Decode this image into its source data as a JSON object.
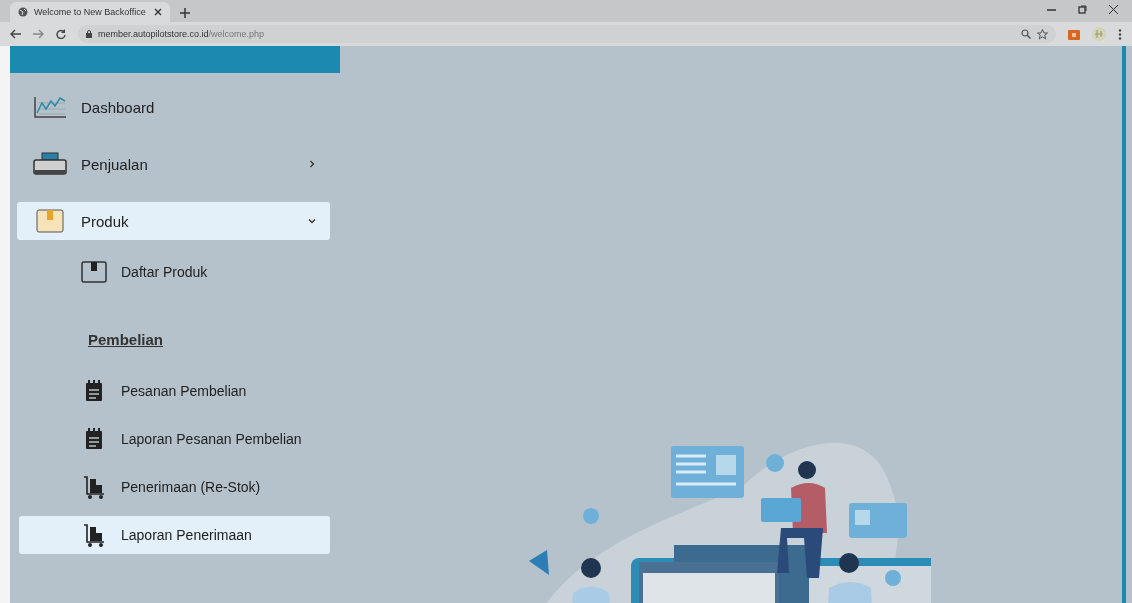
{
  "browser": {
    "tab_title": "Welcome to New Backoffice",
    "url_host": "member.autopilotstore.co.id",
    "url_path": "/welcome.php"
  },
  "sidebar": {
    "menu": [
      {
        "label": "Dashboard",
        "kind": "chart",
        "selected": false
      },
      {
        "label": "Penjualan",
        "kind": "register",
        "selected": false,
        "expanded": false
      },
      {
        "label": "Produk",
        "kind": "box",
        "selected": true,
        "expanded": true,
        "children": [
          {
            "label": "Daftar Produk",
            "kind": "box-outline",
            "selected": false
          }
        ]
      }
    ],
    "section": {
      "title": "Pembelian",
      "items": [
        {
          "label": "Pesanan Pembelian",
          "kind": "notepad",
          "selected": false
        },
        {
          "label": "Laporan Pesanan Pembelian",
          "kind": "notepad",
          "selected": false
        },
        {
          "label": "Penerimaan (Re-Stok)",
          "kind": "cart",
          "selected": false
        },
        {
          "label": "Laporan Penerimaan",
          "kind": "cart",
          "selected": true
        }
      ]
    }
  }
}
